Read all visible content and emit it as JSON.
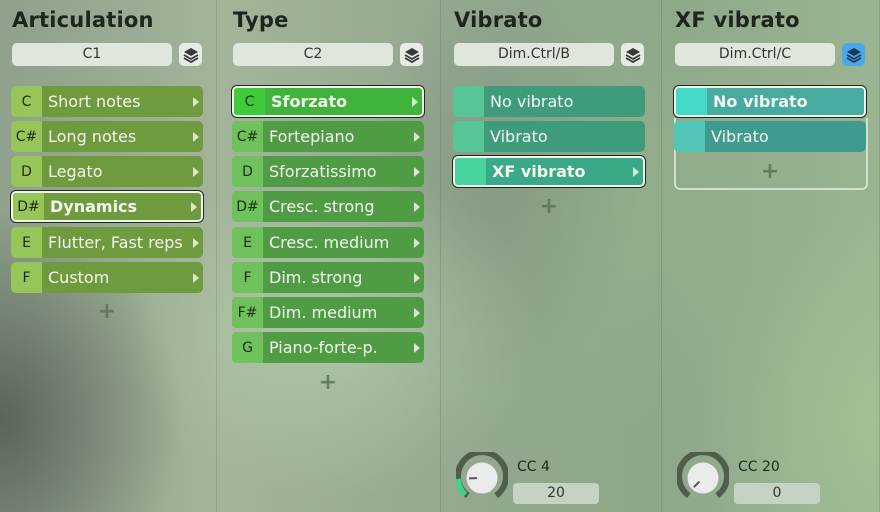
{
  "columns": [
    {
      "title": "Articulation",
      "key_field": "C1",
      "layers_active": false,
      "items": [
        {
          "key": "C",
          "label": "Short notes",
          "selected": false
        },
        {
          "key": "C#",
          "label": "Long notes",
          "selected": false
        },
        {
          "key": "D",
          "label": "Legato",
          "selected": false
        },
        {
          "key": "D#",
          "label": "Dynamics",
          "selected": true
        },
        {
          "key": "E",
          "label": "Flutter, Fast reps",
          "selected": false
        },
        {
          "key": "F",
          "label": "Custom",
          "selected": false
        }
      ],
      "add_label": "+"
    },
    {
      "title": "Type",
      "key_field": "C2",
      "layers_active": false,
      "items": [
        {
          "key": "C",
          "label": "Sforzato",
          "selected": true
        },
        {
          "key": "C#",
          "label": "Fortepiano",
          "selected": false
        },
        {
          "key": "D",
          "label": "Sforzatissimo",
          "selected": false
        },
        {
          "key": "D#",
          "label": "Cresc. strong",
          "selected": false
        },
        {
          "key": "E",
          "label": "Cresc. medium",
          "selected": false
        },
        {
          "key": "F",
          "label": "Dim. strong",
          "selected": false
        },
        {
          "key": "F#",
          "label": "Dim. medium",
          "selected": false
        },
        {
          "key": "G",
          "label": "Piano-forte-p.",
          "selected": false
        }
      ],
      "add_label": "+"
    },
    {
      "title": "Vibrato",
      "key_field": "Dim.Ctrl/B",
      "layers_active": false,
      "items": [
        {
          "key": "",
          "label": "No vibrato",
          "selected": false
        },
        {
          "key": "",
          "label": "Vibrato",
          "selected": false
        },
        {
          "key": "",
          "label": "XF vibrato",
          "selected": true
        }
      ],
      "add_label": "+",
      "controller": {
        "cc_label": "CC 4",
        "value": "20",
        "level": 0.16
      }
    },
    {
      "title": "XF vibrato",
      "key_field": "Dim.Ctrl/C",
      "layers_active": true,
      "items": [
        {
          "key": "",
          "label": "No vibrato",
          "selected": true
        },
        {
          "key": "",
          "label": "Vibrato",
          "selected": false
        }
      ],
      "add_label": "+",
      "controller": {
        "cc_label": "CC 20",
        "value": "0",
        "level": 0
      }
    }
  ],
  "icons": {
    "layers": "layers-icon",
    "arrow": "chevron-right-icon",
    "add": "plus-icon"
  },
  "colors": {
    "layers_active": "#4aa8e8",
    "knob_level": "#3fd08a"
  }
}
